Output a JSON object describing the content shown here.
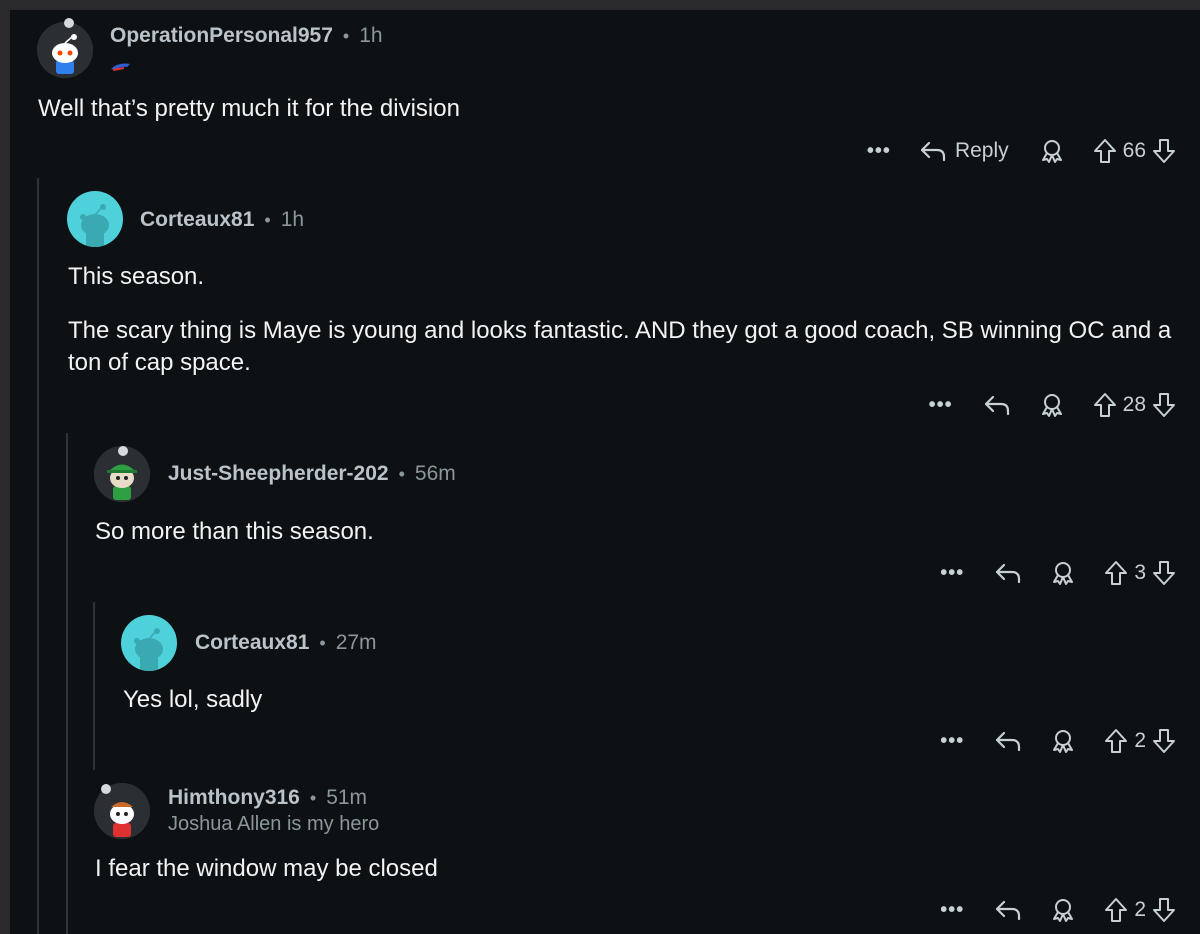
{
  "comments": [
    {
      "username": "OperationPersonal957",
      "time": "1h",
      "flair": "",
      "body": [
        "Well that’s pretty much it for the division"
      ],
      "score": "66",
      "reply_label": "Reply",
      "avatar_icon": "snoo-avatar-blue-shirt",
      "flair_icon": "bills-logo-icon"
    },
    {
      "username": "Corteaux81",
      "time": "1h",
      "flair": "",
      "body": [
        "This season.",
        "The scary thing is Maye is young and looks fantastic. AND they got a good coach, SB winning OC and a ton of cap space."
      ],
      "score": "28",
      "avatar_icon": "default-snoo-avatar-cyan"
    },
    {
      "username": "Just-Sheepherder-202",
      "time": "56m",
      "flair": "",
      "body": [
        "So more than this season."
      ],
      "score": "3",
      "avatar_icon": "snoo-avatar-green-cap"
    },
    {
      "username": "Corteaux81",
      "time": "27m",
      "flair": "",
      "body": [
        "Yes lol, sadly"
      ],
      "score": "2",
      "avatar_icon": "default-snoo-avatar-cyan"
    },
    {
      "username": "Himthony316",
      "time": "51m",
      "flair": "Joshua Allen is my hero",
      "body": [
        "I fear the window may be closed"
      ],
      "score": "2",
      "avatar_icon": "snoo-avatar-red-shirt"
    }
  ],
  "ui": {
    "more_label": "•••",
    "separator": "•"
  },
  "colors": {
    "background": "#0e1113",
    "cyan_avatar": "#4fd1db",
    "username": "#b9c3c9",
    "meta": "#8b969d"
  }
}
